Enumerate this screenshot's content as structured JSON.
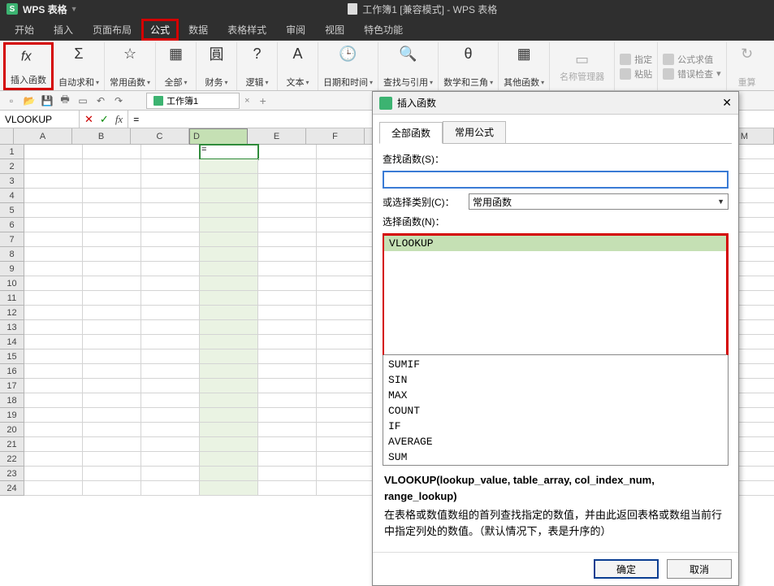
{
  "app": {
    "name": "WPS 表格",
    "logo_char": "S"
  },
  "doc": {
    "title": "工作簿1 [兼容模式] - WPS 表格"
  },
  "menu": {
    "items": [
      {
        "label": "开始"
      },
      {
        "label": "插入"
      },
      {
        "label": "页面布局"
      },
      {
        "label": "公式",
        "active": true,
        "highlight": true
      },
      {
        "label": "数据"
      },
      {
        "label": "表格样式"
      },
      {
        "label": "审阅"
      },
      {
        "label": "视图"
      },
      {
        "label": "特色功能"
      }
    ]
  },
  "ribbon": {
    "insert_fn": "插入函数",
    "autosum": "自动求和",
    "common_fn": "常用函数",
    "all": "全部",
    "finance": "财务",
    "logic": "逻辑",
    "text": "文本",
    "datetime": "日期和时间",
    "lookup": "查找与引用",
    "math": "数学和三角",
    "other": "其他函数",
    "name_mgr": "名称管理器",
    "assign": "指定",
    "paste": "粘贴",
    "eval": "公式求值",
    "errchk": "错误检查",
    "recalc": "重算"
  },
  "qat": {
    "workbook_tab": "工作簿1",
    "close_x": "×",
    "plus": "+"
  },
  "fx": {
    "name_value": "VLOOKUP",
    "x": "✕",
    "check": "✓",
    "fx": "fx",
    "formula": "="
  },
  "columns": [
    "A",
    "B",
    "C",
    "D",
    "E",
    "F",
    "",
    "",
    "",
    "",
    "",
    "",
    "M"
  ],
  "rows_count": 24,
  "active_col_index": 3,
  "active_row_index": 0,
  "active_cell_display": "=",
  "dialog": {
    "title": "插入函数",
    "tab_all": "全部函数",
    "tab_common": "常用公式",
    "search_label": "查找函数(S)：",
    "category_label": "或选择类别(C)：",
    "category_value": "常用函数",
    "select_fn_label": "选择函数(N)：",
    "functions": [
      "VLOOKUP",
      "SUMIF",
      "SIN",
      "MAX",
      "COUNT",
      "IF",
      "AVERAGE",
      "SUM"
    ],
    "selected_fn_index": 0,
    "signature": "VLOOKUP(lookup_value, table_array, col_index_num, range_lookup)",
    "description": "在表格或数值数组的首列查找指定的数值，并由此返回表格或数组当前行中指定列处的数值。（默认情况下，表是升序的）",
    "ok": "确定",
    "cancel": "取消",
    "close_x": "✕"
  }
}
